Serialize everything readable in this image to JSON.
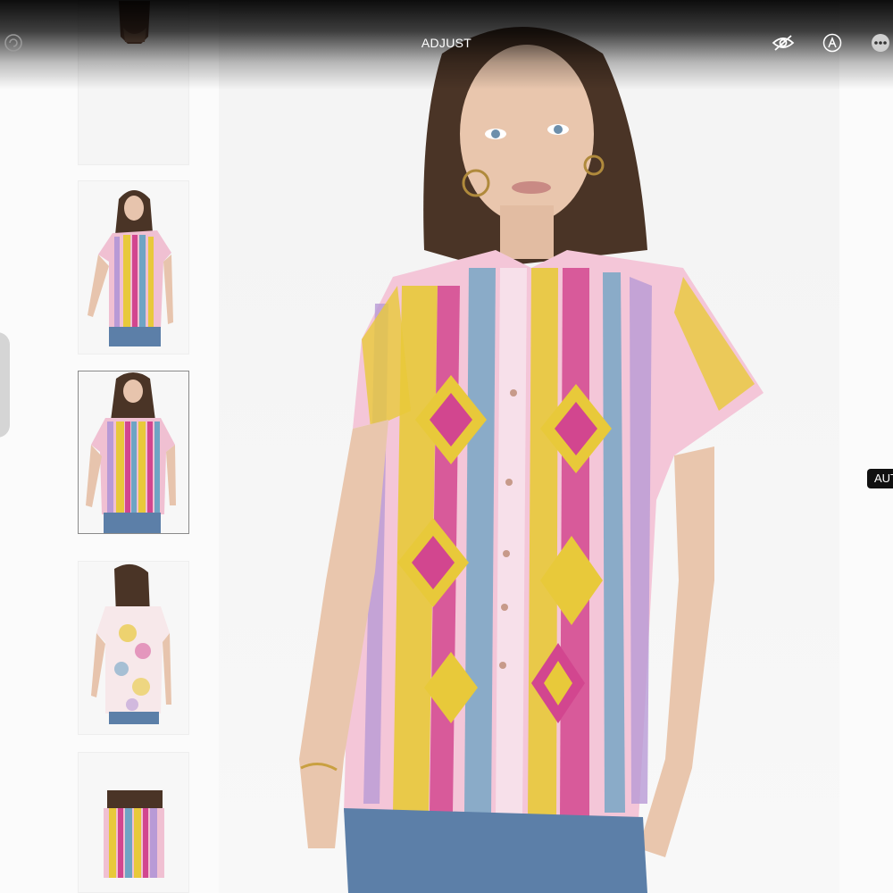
{
  "toolbar": {
    "title": "ADJUST",
    "icons": [
      "rotate-icon",
      "hide-icon",
      "markup-icon",
      "more-icon"
    ]
  },
  "thumbnails": [
    {
      "label": "product-photo-1"
    },
    {
      "label": "product-photo-2"
    },
    {
      "label": "product-photo-3",
      "selected": true
    },
    {
      "label": "product-photo-4"
    },
    {
      "label": "product-photo-5"
    }
  ],
  "badge": {
    "text": "AUTO"
  },
  "colors": {
    "magenta": "#d2468f",
    "yellow": "#e8c93a",
    "orange": "#e49a3a",
    "blue": "#6fa4c4",
    "lavender": "#b89ad6",
    "pink": "#f2b8cf",
    "denim": "#5c7fa8"
  }
}
